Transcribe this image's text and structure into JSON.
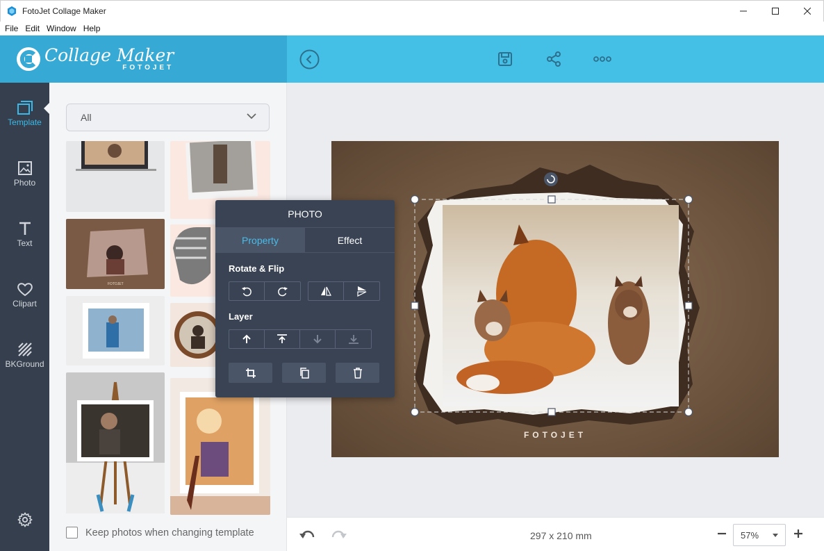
{
  "window": {
    "title": "FotoJet Collage Maker"
  },
  "menu": [
    "File",
    "Edit",
    "Window",
    "Help"
  ],
  "logo": {
    "script": "Collage Maker",
    "sub": "FOTOJET"
  },
  "toolbar": {
    "icons": [
      "back-icon",
      "save-icon",
      "share-icon",
      "more-icon"
    ]
  },
  "nav": {
    "items": [
      {
        "label": "Template",
        "icon": "template-icon",
        "active": true
      },
      {
        "label": "Photo",
        "icon": "photo-icon",
        "active": false
      },
      {
        "label": "Text",
        "icon": "text-icon",
        "active": false
      },
      {
        "label": "Clipart",
        "icon": "heart-icon",
        "active": false
      },
      {
        "label": "BKGround",
        "icon": "background-icon",
        "active": false
      }
    ],
    "settings_icon": "gear-icon"
  },
  "panel": {
    "category": "All",
    "keep_photos_label": "Keep photos when changing template",
    "keep_photos_checked": false,
    "thumb_texts": [
      "FOTOJET"
    ]
  },
  "canvas": {
    "watermark": "FOTOJET",
    "size_label": "297 x 210 mm",
    "zoom": "57%"
  },
  "popup": {
    "title": "PHOTO",
    "tabs": [
      "Property",
      "Effect"
    ],
    "active_tab": "Property",
    "rotate_flip_label": "Rotate & Flip",
    "layer_label": "Layer"
  },
  "colors": {
    "logo_bg": "#36a9d4",
    "toolbar_bg": "#44c0e7",
    "nav_bg": "#363f4d",
    "accent": "#3cb9e6",
    "popup_bg": "#394354"
  }
}
